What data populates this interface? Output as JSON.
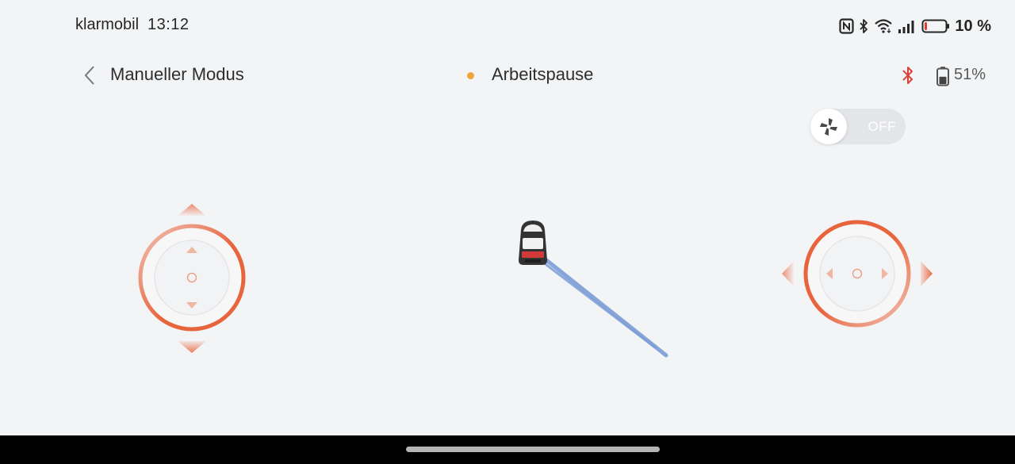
{
  "status_bar": {
    "carrier": "klarmobil",
    "time": "13:12",
    "battery_percent": "10 %",
    "battery_level": 0.1,
    "icons": [
      "nfc-icon",
      "bluetooth-icon",
      "wifi-icon",
      "signal-icon",
      "battery-icon"
    ]
  },
  "header": {
    "back_icon": "chevron-left-icon",
    "title": "Manueller Modus",
    "status_text": "Arbeitspause",
    "status_color": "#f0a33c",
    "bluetooth_color": "#d9423a",
    "mower_battery": "51%",
    "mower_battery_level": 0.51
  },
  "blade_toggle": {
    "icon": "blade-icon",
    "state_label": "OFF",
    "on": false
  },
  "controls": {
    "accent_color": "#e8643c",
    "left_joystick": {
      "name": "forward-backward",
      "icons": [
        "arrow-up-icon",
        "arrow-down-icon"
      ]
    },
    "right_joystick": {
      "name": "left-right",
      "icons": [
        "arrow-left-icon",
        "arrow-right-icon"
      ]
    }
  },
  "map": {
    "path_color": "#7b9cd6",
    "mower_icon": "mower-icon"
  }
}
